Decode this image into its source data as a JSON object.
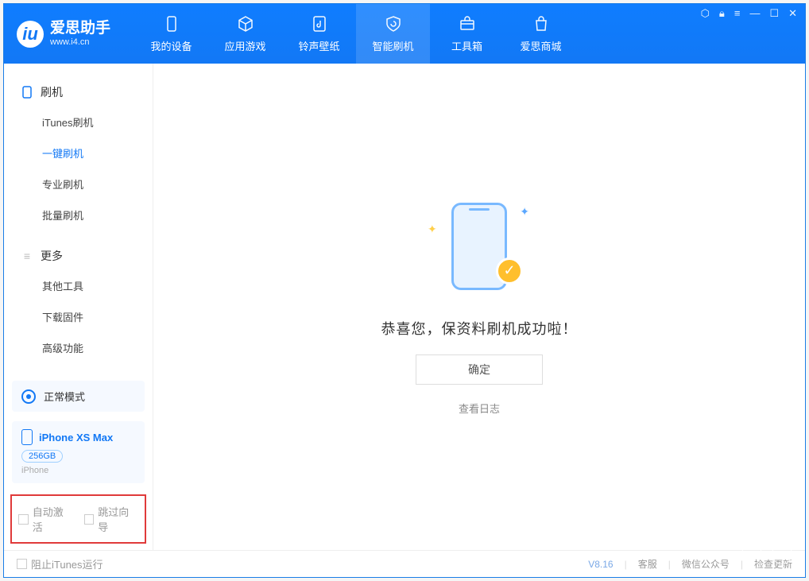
{
  "app": {
    "name": "爱思助手",
    "url": "www.i4.cn"
  },
  "tabs": [
    {
      "label": "我的设备"
    },
    {
      "label": "应用游戏"
    },
    {
      "label": "铃声壁纸"
    },
    {
      "label": "智能刷机"
    },
    {
      "label": "工具箱"
    },
    {
      "label": "爱思商城"
    }
  ],
  "sidebar": {
    "section1_title": "刷机",
    "section1_items": [
      "iTunes刷机",
      "一键刷机",
      "专业刷机",
      "批量刷机"
    ],
    "section2_title": "更多",
    "section2_items": [
      "其他工具",
      "下载固件",
      "高级功能"
    ]
  },
  "mode": {
    "label": "正常模式"
  },
  "device": {
    "name": "iPhone XS Max",
    "capacity": "256GB",
    "type": "iPhone"
  },
  "options": {
    "auto_activate": "自动激活",
    "skip_wizard": "跳过向导"
  },
  "main": {
    "success_msg": "恭喜您，保资料刷机成功啦！",
    "ok_btn": "确定",
    "log_link": "查看日志"
  },
  "footer": {
    "block_itunes": "阻止iTunes运行",
    "version": "V8.16",
    "support": "客服",
    "wechat": "微信公众号",
    "update": "检查更新"
  }
}
